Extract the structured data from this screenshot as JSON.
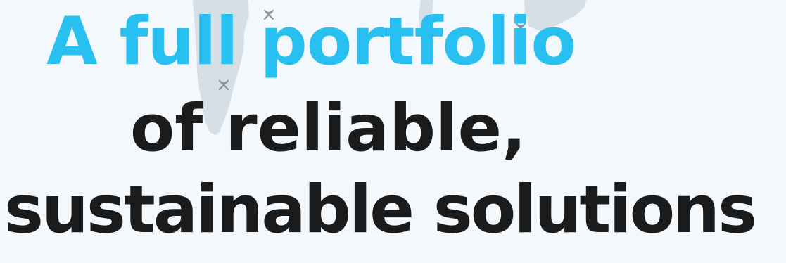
{
  "headline": {
    "line1": "A full portfolio",
    "line2": "of reliable,",
    "line3": "sustainable solutions"
  },
  "colors": {
    "background": "#f2f8fc",
    "map_land": "#d6dfe6",
    "marker": "#8a949c",
    "accent_text": "#27c0f0",
    "dark_text": "#1b1b1b"
  },
  "icons": {
    "location_marker": "location-marker-icon"
  }
}
